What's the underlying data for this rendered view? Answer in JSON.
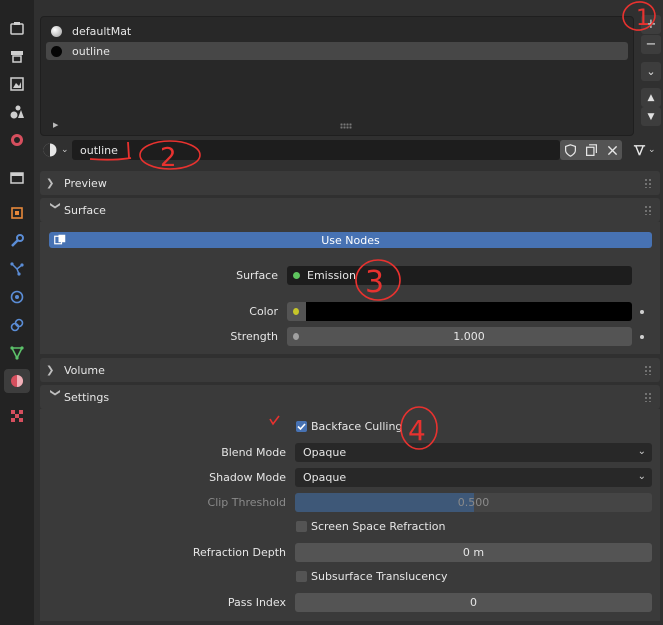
{
  "materials": {
    "slots": [
      {
        "name": "defaultMat",
        "ball": "white-sphere"
      },
      {
        "name": "outline",
        "ball": "black-sphere"
      }
    ],
    "selected": "outline"
  },
  "side_buttons": {
    "add": "+",
    "remove": "−",
    "specials": "⌄",
    "up": "▲",
    "down": "▼"
  },
  "id_block": {
    "name": "outline"
  },
  "panels": {
    "preview": "Preview",
    "surface": "Surface",
    "volume": "Volume",
    "settings": "Settings"
  },
  "surface": {
    "use_nodes_label": "Use Nodes",
    "surface_label": "Surface",
    "surface_value": "Emission",
    "color_label": "Color",
    "strength_label": "Strength",
    "strength_value": "1.000",
    "colors": {
      "surface_dot": "#5ec45e",
      "color_dot": "#c7c729",
      "strength_dot": "#a0a0a0",
      "color_swatch": "#000000",
      "use_nodes_bg": "#4772b3"
    }
  },
  "settings": {
    "backface_culling_label": "Backface Culling",
    "backface_culling": true,
    "blend_mode_label": "Blend Mode",
    "blend_mode_value": "Opaque",
    "shadow_mode_label": "Shadow Mode",
    "shadow_mode_value": "Opaque",
    "clip_threshold_label": "Clip Threshold",
    "clip_threshold_value": "0.500",
    "clip_threshold_fraction": 0.5,
    "ssr_label": "Screen Space Refraction",
    "ssr": false,
    "refraction_depth_label": "Refraction Depth",
    "refraction_depth_value": "0 m",
    "subsurface_label": "Subsurface Translucency",
    "subsurface": false,
    "pass_index_label": "Pass Index",
    "pass_index_value": "0"
  },
  "annotations": {
    "marks": [
      "1",
      "2",
      "3",
      "4"
    ],
    "color": "#e8322f"
  }
}
